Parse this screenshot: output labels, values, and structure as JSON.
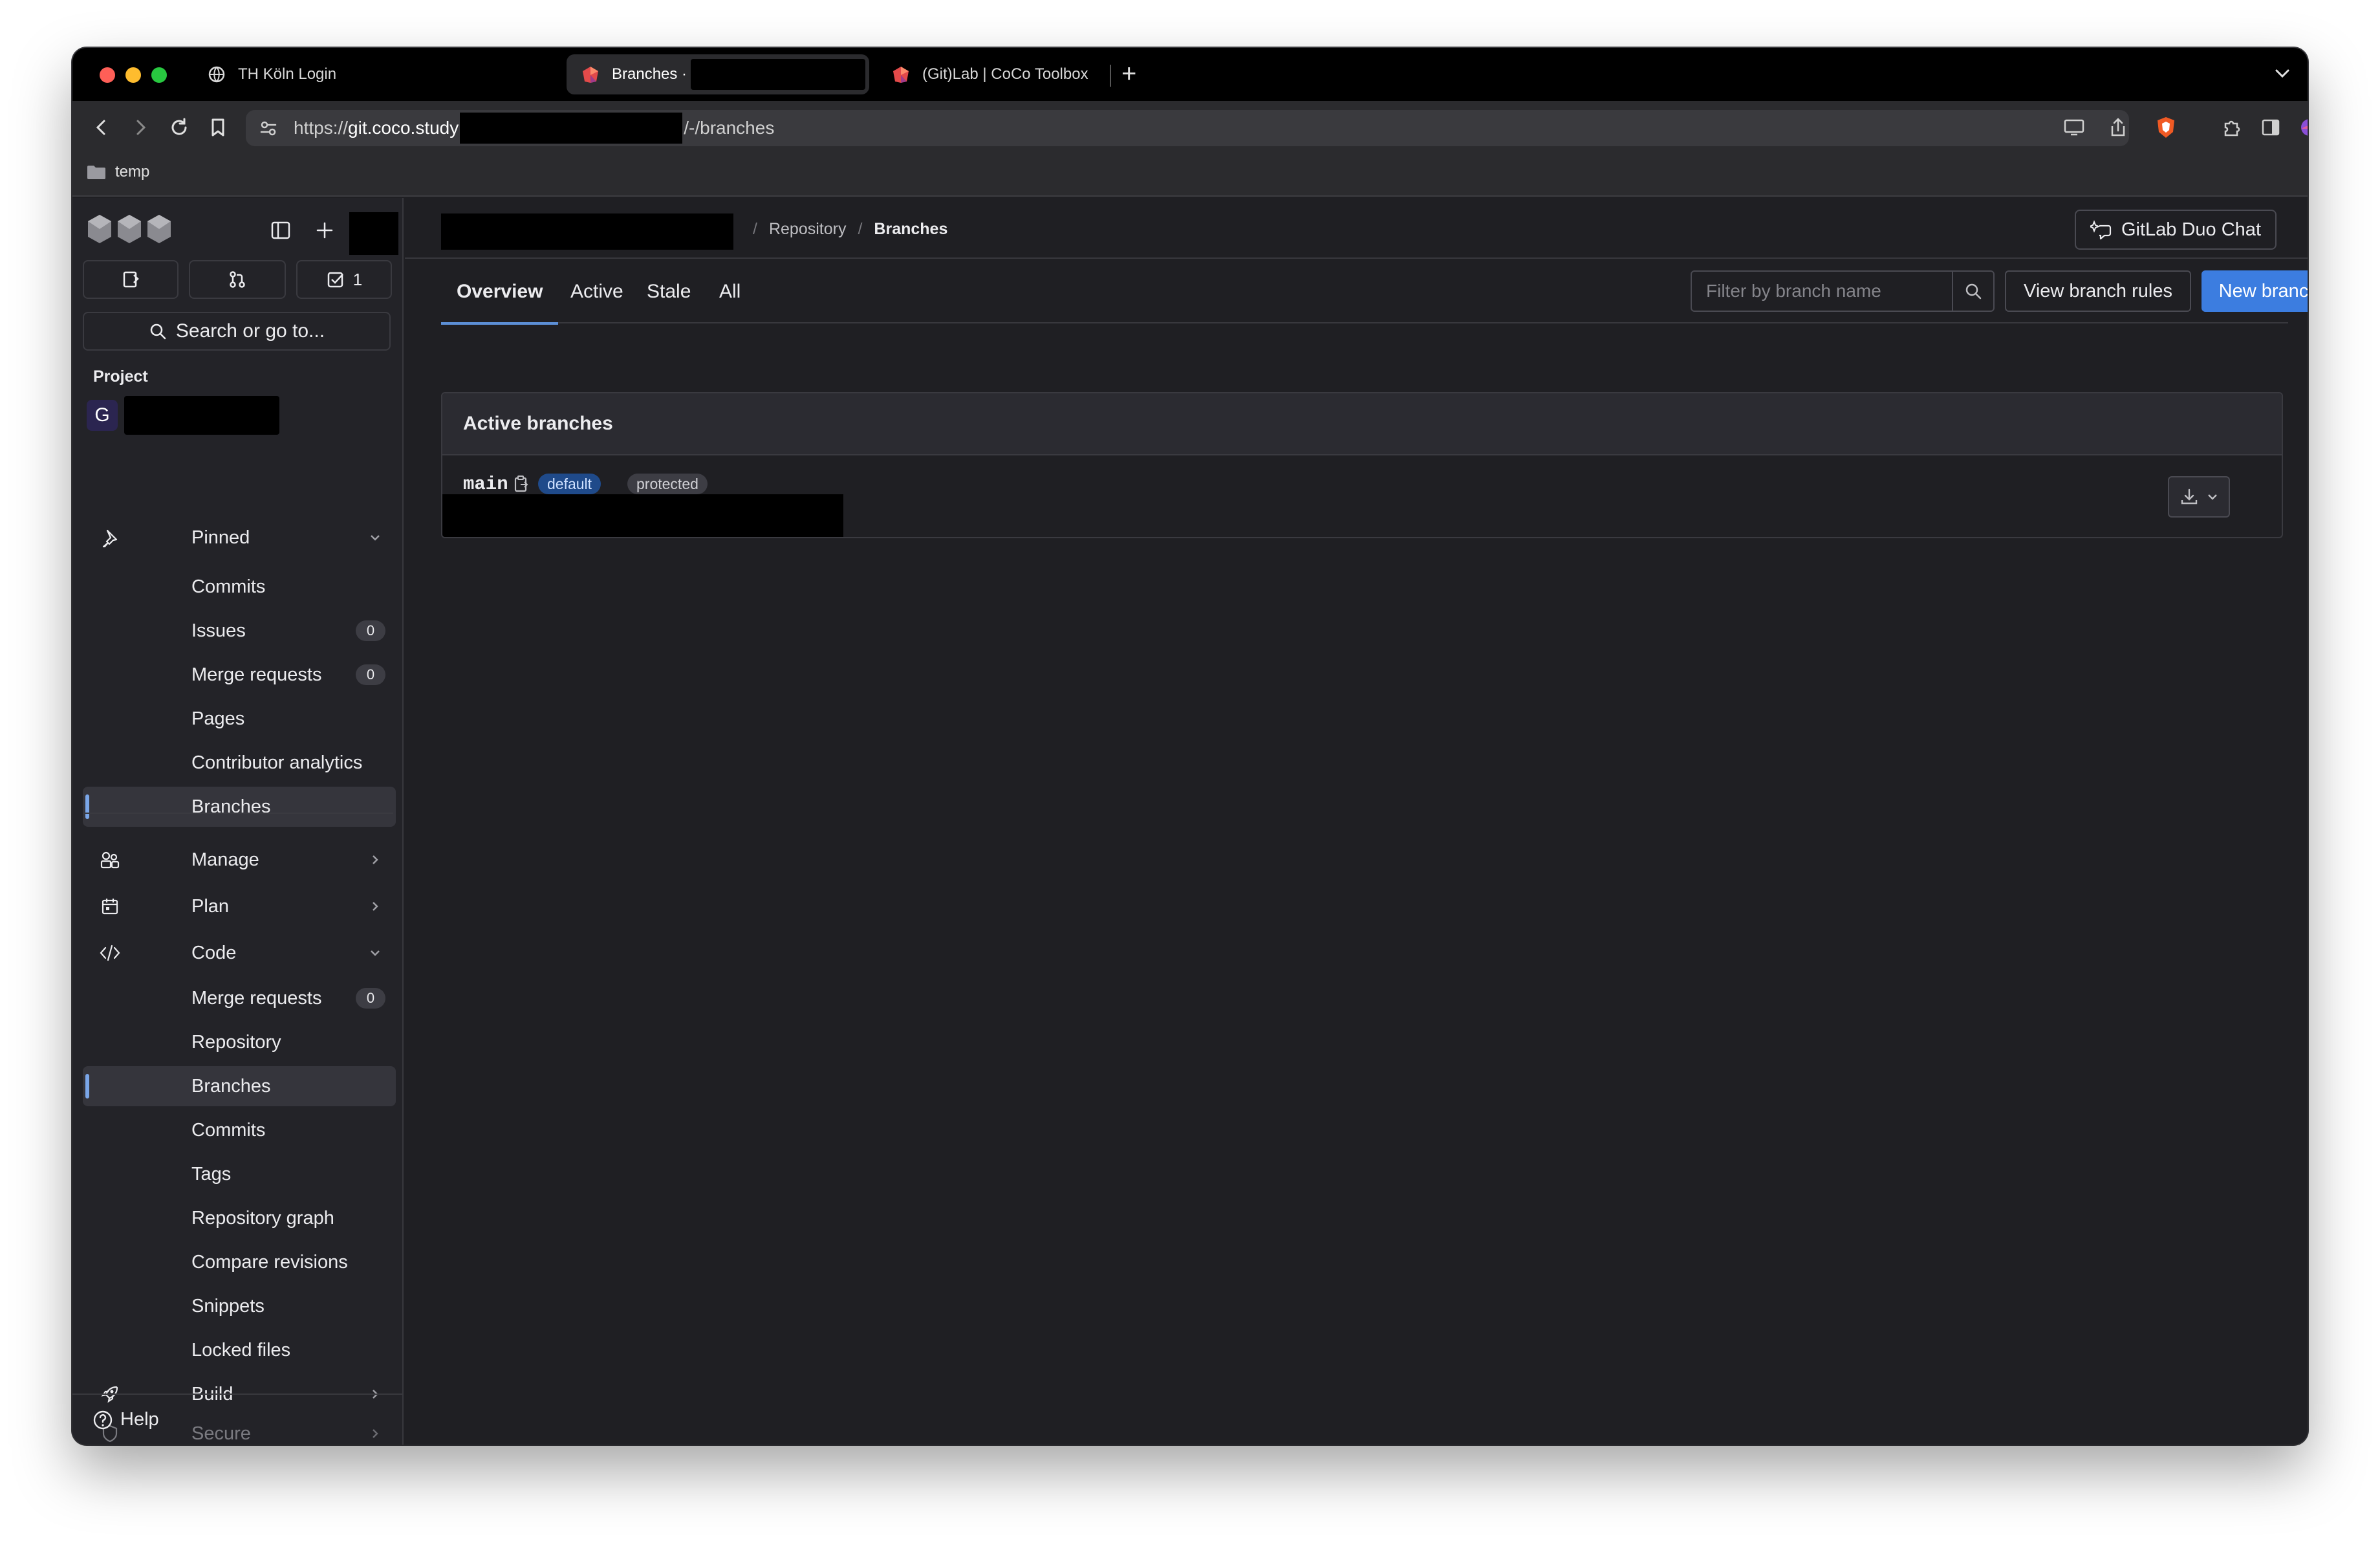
{
  "browser": {
    "tabs": [
      {
        "title": "TH Köln Login",
        "active": false
      },
      {
        "title": "Branches ·",
        "active": true
      },
      {
        "title": "(Git)Lab | CoCo Toolbox",
        "active": false
      }
    ],
    "url": {
      "prefix": "https://",
      "domain": "git.coco.study",
      "suffix": "/-/branches"
    },
    "bookmarks": [
      {
        "label": "temp"
      }
    ]
  },
  "sidebar": {
    "quick_actions": {
      "todo_count": "1"
    },
    "search_label": "Search or go to...",
    "section_title": "Project",
    "project_avatar_letter": "G",
    "pinned": {
      "label": "Pinned",
      "items": [
        {
          "label": "Commits"
        },
        {
          "label": "Issues",
          "count": "0"
        },
        {
          "label": "Merge requests",
          "count": "0"
        },
        {
          "label": "Pages"
        },
        {
          "label": "Contributor analytics"
        },
        {
          "label": "Branches"
        }
      ]
    },
    "groups": [
      {
        "label": "Manage"
      },
      {
        "label": "Plan"
      },
      {
        "label": "Code"
      }
    ],
    "code_items": [
      {
        "label": "Merge requests",
        "count": "0"
      },
      {
        "label": "Repository"
      },
      {
        "label": "Branches"
      },
      {
        "label": "Commits"
      },
      {
        "label": "Tags"
      },
      {
        "label": "Repository graph"
      },
      {
        "label": "Compare revisions"
      },
      {
        "label": "Snippets"
      },
      {
        "label": "Locked files"
      }
    ],
    "more_groups": [
      {
        "label": "Build"
      },
      {
        "label": "Secure"
      }
    ],
    "help_label": "Help"
  },
  "header": {
    "breadcrumb": {
      "repository": "Repository",
      "current": "Branches"
    },
    "duo_chat_label": "GitLab Duo Chat"
  },
  "tabs": [
    {
      "label": "Overview"
    },
    {
      "label": "Active"
    },
    {
      "label": "Stale"
    },
    {
      "label": "All"
    }
  ],
  "filter": {
    "placeholder": "Filter by branch name"
  },
  "buttons": {
    "view_rules": "View branch rules",
    "new_branch": "New branch"
  },
  "active_branches": {
    "title": "Active branches",
    "branches": [
      {
        "name": "main",
        "badges": [
          "default",
          "protected"
        ]
      }
    ]
  },
  "colors": {
    "primary_button": "#3c7de0",
    "badge_default": "#1f4a8a",
    "selected_indicator": "#7aa6e8"
  }
}
